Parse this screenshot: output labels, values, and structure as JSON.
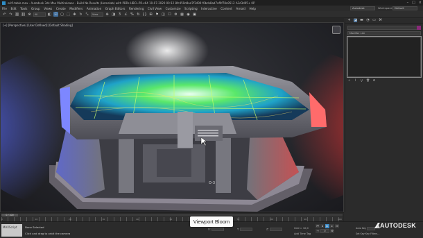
{
  "window": {
    "title": "scifi-table.max - Autodesk 3ds Max Multirelease - Build No Results (Homelab) with PBRs HBCL-PR-x64 10-07-2020 00:12 8fc459d4ad7f3499 f0bcb8ad7af9f78a9512 A3d3d95+ 0P",
    "controls": [
      "–",
      "□",
      "×"
    ]
  },
  "menu": {
    "items": [
      "File",
      "Edit",
      "Tools",
      "Group",
      "Views",
      "Create",
      "Modifiers",
      "Animation",
      "Graph Editors",
      "Rendering",
      "Civil View",
      "Customize",
      "Scripting",
      "Interactive",
      "Content",
      "Arnold",
      "Help"
    ],
    "user": "Autodesk",
    "workspaces_label": "Workspaces:",
    "workspace": "Default"
  },
  "toolbar": {
    "buttons": [
      "↶",
      "↷",
      "⛓",
      "⛓",
      "⊗",
      "All",
      "◧",
      "⊡",
      "▢",
      "⬚",
      "✥",
      "↻",
      "⤡",
      "View",
      "⊕",
      "◨",
      "3",
      "∠",
      "%",
      "⇅",
      "{}",
      "⊞",
      "⚑",
      "◫",
      "☐",
      "⚙",
      "▦",
      "◉",
      "▣"
    ],
    "filter_select": "All",
    "coord_select": "View"
  },
  "viewport": {
    "label": "[+] [Perspective] [User Defined] [Default Shading]"
  },
  "command_panel": {
    "tabs": [
      "+",
      "◪",
      "▬",
      "◔",
      "▭",
      "⚒"
    ],
    "modifier_list": "Modifier List",
    "stack_tools": [
      "⊣",
      "Ⅰ",
      "⋁",
      "🗑",
      "⚙"
    ]
  },
  "timeline": {
    "slider": "0 / 100",
    "ticks": [
      "0",
      "10",
      "20",
      "30",
      "40",
      "50",
      "60",
      "70",
      "80",
      "90",
      "100"
    ]
  },
  "statusbar": {
    "maxscript": "MAXScript",
    "selection": "None Selected",
    "prompt": "Click and drag to orbit the camera",
    "x_label": "X:",
    "y_label": "Y:",
    "z_label": "Z:",
    "grid": "Grid = 10,0",
    "time_tag": "Add Time Tag",
    "frame": "0",
    "auto_key": "Auto Key",
    "set_key": "Set Key",
    "selected": "Selected",
    "key_filters": "Key Filters..."
  },
  "caption": "Viewport Bloom",
  "brand": "AUTODESK",
  "colors": {
    "accent_blue": "#3d8cc8",
    "bloom_left": "#4a6cff",
    "bloom_right": "#ff3a3a",
    "hologram": "#6cff5a"
  }
}
